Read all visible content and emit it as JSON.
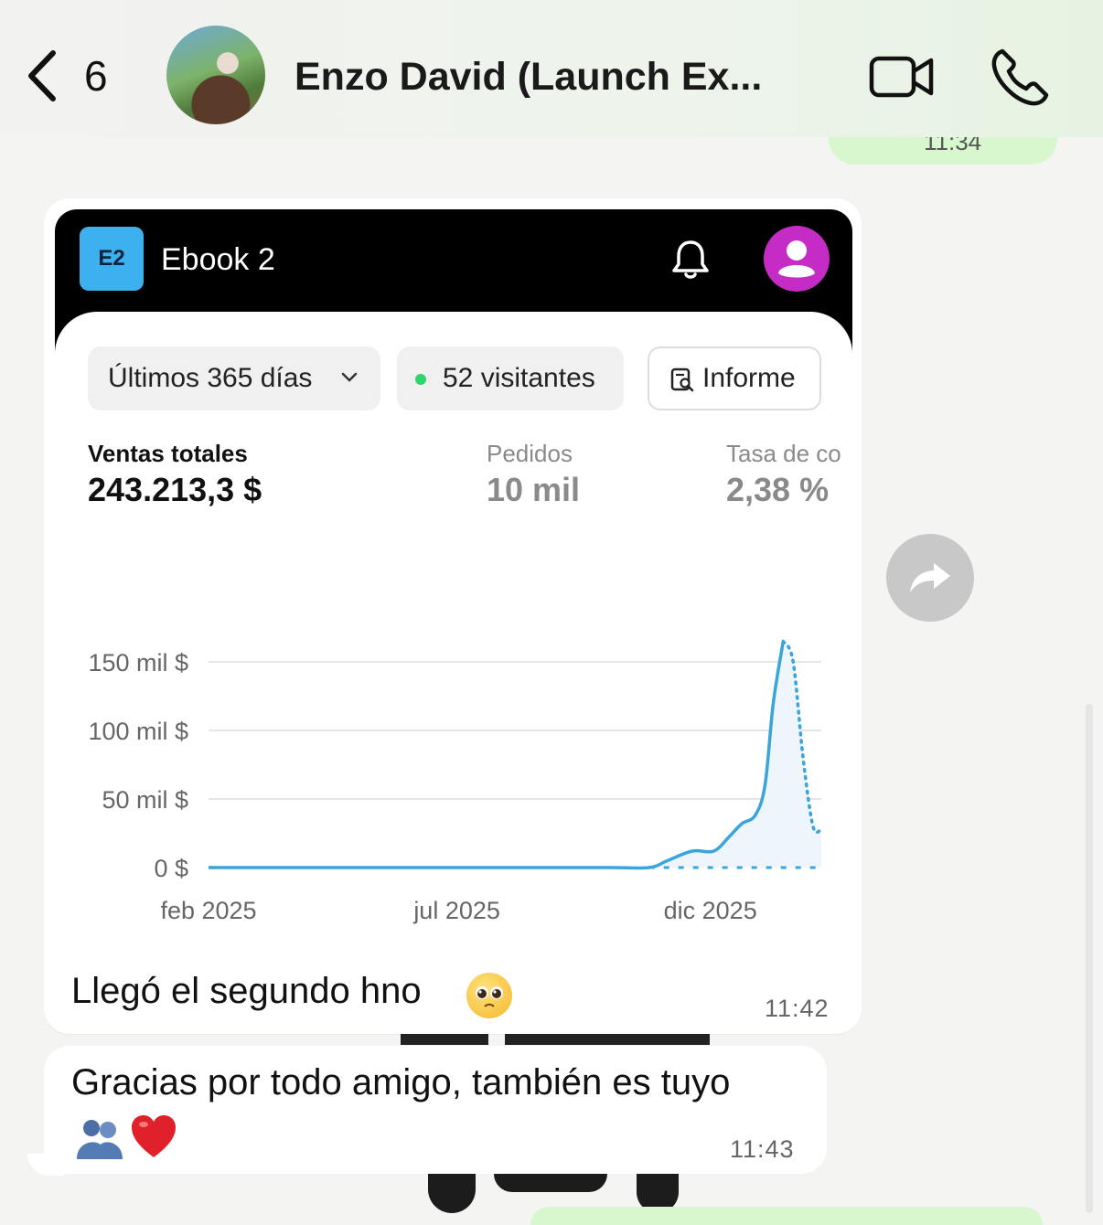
{
  "header": {
    "unread_count": "6",
    "contact_name": "Enzo David (Launch Ex..."
  },
  "previous_message": {
    "time": "11:34"
  },
  "message1": {
    "store": {
      "badge": "E2",
      "name": "Ebook 2"
    },
    "filters": {
      "period": "Últimos 365 días",
      "visitors": "52 visitantes",
      "report": "Informe"
    },
    "metrics": [
      {
        "label": "Ventas totales",
        "value": "243.213,3 $"
      },
      {
        "label": "Pedidos",
        "value": "10 mil"
      },
      {
        "label": "Tasa de co",
        "value": "2,38 %"
      }
    ],
    "caption": "Llegó el segundo hno",
    "time": "11:42"
  },
  "chart_data": {
    "type": "line",
    "title": "",
    "xlabel": "",
    "ylabel": "",
    "x_ticks": [
      "feb 2025",
      "jul 2025",
      "dic 2025"
    ],
    "y_ticks": [
      "0 $",
      "50 mil $",
      "100 mil $",
      "150 mil $"
    ],
    "ylim": [
      0,
      170000
    ],
    "grid": true,
    "series": [
      {
        "style": "solid",
        "x": [
          "2025-02-01",
          "2025-04-01",
          "2025-06-01",
          "2025-08-01",
          "2025-10-01",
          "2025-10-25",
          "2025-11-05",
          "2025-11-20",
          "2025-12-03",
          "2025-12-12",
          "2025-12-20",
          "2025-12-28",
          "2026-01-03",
          "2026-01-08",
          "2026-01-14"
        ],
        "values": [
          0,
          0,
          0,
          0,
          0,
          0,
          5000,
          12000,
          12000,
          22000,
          32000,
          38000,
          60000,
          120000,
          165000
        ]
      },
      {
        "style": "dotted",
        "x": [
          "2026-01-14",
          "2026-01-20",
          "2026-01-26",
          "2026-02-01",
          "2026-02-06"
        ],
        "values": [
          165000,
          150000,
          80000,
          30000,
          28000
        ]
      },
      {
        "style": "dashed",
        "x": [
          "2025-10-25",
          "2026-02-06"
        ],
        "values": [
          0,
          0
        ]
      }
    ],
    "colors": {
      "line": "#3aa4dc",
      "fill": "#eef6fb",
      "grid": "#e6e6e6"
    }
  },
  "message2": {
    "caption": "Gracias por todo amigo, también es tuyo",
    "time": "11:43"
  },
  "icons": [
    "chevron-left-icon",
    "video-call-icon",
    "phone-icon",
    "bell-icon",
    "user-icon",
    "chevron-down-icon",
    "report-icon",
    "forward-icon"
  ]
}
